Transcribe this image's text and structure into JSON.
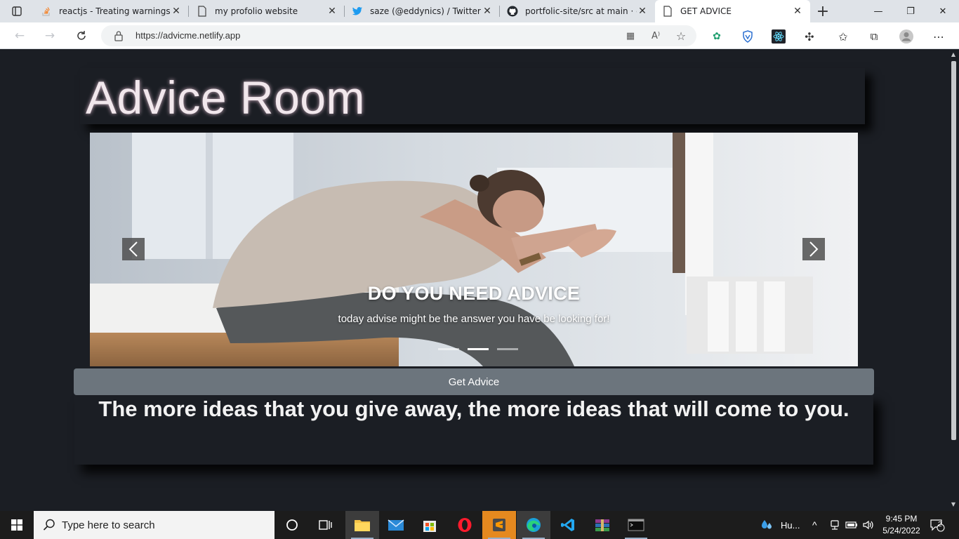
{
  "browser": {
    "tabs": [
      {
        "label": "reactjs - Treating warnings as",
        "icon": "stackoverflow-icon"
      },
      {
        "label": "my profolio website",
        "icon": "page-icon"
      },
      {
        "label": "saze (@eddynics) / Twitter",
        "icon": "twitter-icon"
      },
      {
        "label": "portfolic-site/src at main · edd",
        "icon": "github-icon"
      },
      {
        "label": "GET ADVICE",
        "icon": "page-icon",
        "active": true
      }
    ],
    "url": "https://advicme.netlify.app"
  },
  "page": {
    "title": "Advice Room",
    "carousel": {
      "heading": "DO YOU NEED ADVICE",
      "subtext": "today advise might be the answer you have be looking for!",
      "active_indicator": 2,
      "indicator_count": 3
    },
    "button_label": "Get Advice",
    "advice": "The more ideas that you give away, the more ideas that will come to you."
  },
  "taskbar": {
    "search_placeholder": "Type here to search",
    "weather": "Hu...",
    "time": "9:45 PM",
    "date": "5/24/2022",
    "notifications": "2"
  },
  "colors": {
    "page_bg": "#1b1e24",
    "title_text": "#f1e7ec",
    "button_bg": "#6c757d"
  }
}
